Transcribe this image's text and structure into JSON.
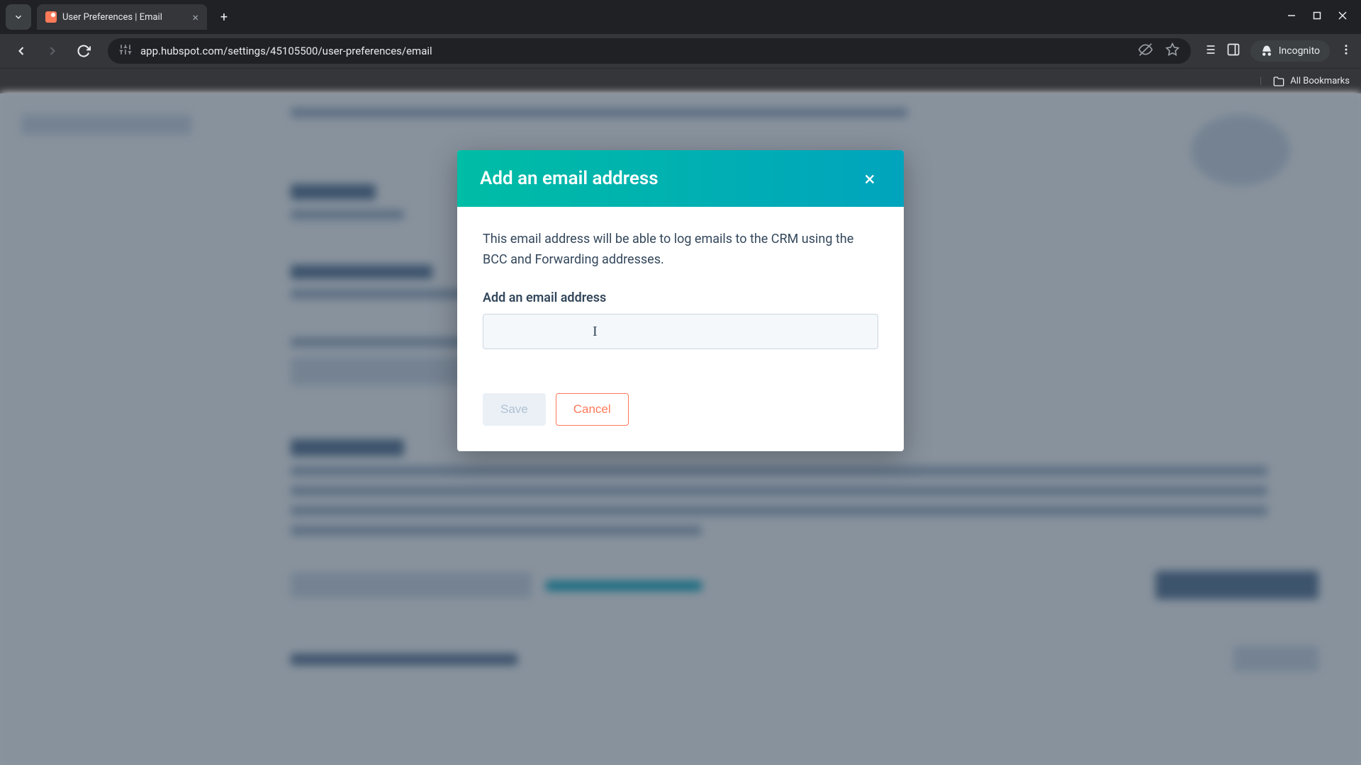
{
  "browser": {
    "tab_title": "User Preferences | Email",
    "url": "app.hubspot.com/settings/45105500/user-preferences/email",
    "incognito_label": "Incognito",
    "bookmarks_label": "All Bookmarks"
  },
  "modal": {
    "title": "Add an email address",
    "description": "This email address will be able to log emails to the CRM using the BCC and Forwarding addresses.",
    "field_label": "Add an email address",
    "input_value": "",
    "save_label": "Save",
    "cancel_label": "Cancel"
  },
  "colors": {
    "hubspot_orange": "#ff7a59",
    "teal_start": "#00bda5",
    "teal_end": "#00a4bd",
    "text": "#33475b"
  }
}
